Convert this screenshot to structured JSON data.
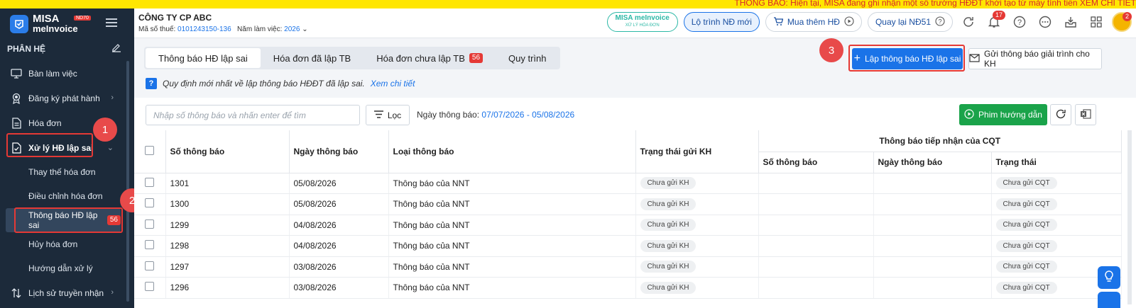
{
  "notice": {
    "text": "THÔNG BÁO: Hiện tại, MISA đang ghi nhận một số trường HĐĐT khởi tạo từ máy tính tiền   XEM CHI TIẾT"
  },
  "brand": {
    "line1": "MISA",
    "line2": "meInvoice",
    "tag": "ND70"
  },
  "sidebar": {
    "section_title": "PHÂN HỆ",
    "items": [
      {
        "label": "Bàn làm việc",
        "icon": "monitor-icon",
        "has_chevron": false
      },
      {
        "label": "Đăng ký phát hành",
        "icon": "badge-icon",
        "has_chevron": true
      },
      {
        "label": "Hóa đơn",
        "icon": "document-icon",
        "has_chevron": false
      },
      {
        "label": "Xử lý HĐ lập sai",
        "icon": "document-check-icon",
        "has_chevron": true,
        "expanded": true
      }
    ],
    "subitems": [
      {
        "label": "Thay thế hóa đơn"
      },
      {
        "label": "Điều chỉnh hóa đơn"
      },
      {
        "label": "Thông báo HĐ lập sai",
        "badge": "56",
        "active": true
      },
      {
        "label": "Hủy hóa đơn"
      },
      {
        "label": "Hướng dẫn xử lý"
      }
    ],
    "history": {
      "label": "Lịch sử truyền nhận",
      "icon": "sort-arrows-icon"
    }
  },
  "steps": {
    "one": "1",
    "two": "2",
    "three": "3"
  },
  "header": {
    "company": "CÔNG TY CP ABC",
    "tax_label": "Mã số thuế:",
    "tax_value": "0101243150-136",
    "year_label": "Năm làm việc:",
    "year_value": "2026",
    "misa_chip_1": "MISA meInvoice",
    "misa_chip_2": "XỬ LÝ HÓA ĐƠN",
    "roadmap": "Lộ trình NĐ mới",
    "buy_more": "Mua thêm HĐ",
    "back_nd51": "Quay lại NĐ51",
    "notif_count": "17",
    "avatar_badge": "2"
  },
  "tabs": [
    {
      "label": "Thông báo HĐ lập sai",
      "active": true
    },
    {
      "label": "Hóa đơn đã lập TB"
    },
    {
      "label": "Hóa đơn chưa lập TB",
      "badge": "56"
    },
    {
      "label": "Quy trình"
    }
  ],
  "actions": {
    "create": "Lập thông báo HĐ lập sai",
    "send_explain": "Gửi thông báo giải trình cho KH"
  },
  "info": {
    "text": "Quy định mới nhất về lập thông báo HĐĐT đã lập sai.",
    "link": "Xem chi tiết"
  },
  "toolbar": {
    "search_placeholder": "Nhập số thông báo và nhấn enter để tìm",
    "filter": "Lọc",
    "date_label": "Ngày thông báo:",
    "date_value": "07/07/2026 - 05/08/2026",
    "guide_video": "Phim hướng dẫn"
  },
  "table": {
    "headers": {
      "number": "Số thông báo",
      "date": "Ngày thông báo",
      "type": "Loại thông báo",
      "send_status": "Trạng thái gửi KH",
      "cqt_group": "Thông báo tiếp nhận của CQT",
      "cqt_number": "Số thông báo",
      "cqt_date": "Ngày thông báo",
      "cqt_status": "Trạng thái"
    },
    "rows": [
      {
        "number": "1301",
        "date": "05/08/2026",
        "type": "Thông báo của NNT",
        "send_status": "Chưa gửi KH",
        "cqt_number": "",
        "cqt_date": "",
        "cqt_status": "Chưa gửi CQT"
      },
      {
        "number": "1300",
        "date": "05/08/2026",
        "type": "Thông báo của NNT",
        "send_status": "Chưa gửi KH",
        "cqt_number": "",
        "cqt_date": "",
        "cqt_status": "Chưa gửi CQT"
      },
      {
        "number": "1299",
        "date": "04/08/2026",
        "type": "Thông báo của NNT",
        "send_status": "Chưa gửi KH",
        "cqt_number": "",
        "cqt_date": "",
        "cqt_status": "Chưa gửi CQT"
      },
      {
        "number": "1298",
        "date": "04/08/2026",
        "type": "Thông báo của NNT",
        "send_status": "Chưa gửi KH",
        "cqt_number": "",
        "cqt_date": "",
        "cqt_status": "Chưa gửi CQT"
      },
      {
        "number": "1297",
        "date": "03/08/2026",
        "type": "Thông báo của NNT",
        "send_status": "Chưa gửi KH",
        "cqt_number": "",
        "cqt_date": "",
        "cqt_status": "Chưa gửi CQT"
      },
      {
        "number": "1296",
        "date": "03/08/2026",
        "type": "Thông báo của NNT",
        "send_status": "Chưa gửi KH",
        "cqt_number": "",
        "cqt_date": "",
        "cqt_status": "Chưa gửi CQT"
      }
    ]
  },
  "colors": {
    "accent": "#1a73e8",
    "sidebar": "#1c2a3a",
    "danger": "#e53935",
    "success": "#1aa34a",
    "notice_bg": "#ffe600"
  }
}
